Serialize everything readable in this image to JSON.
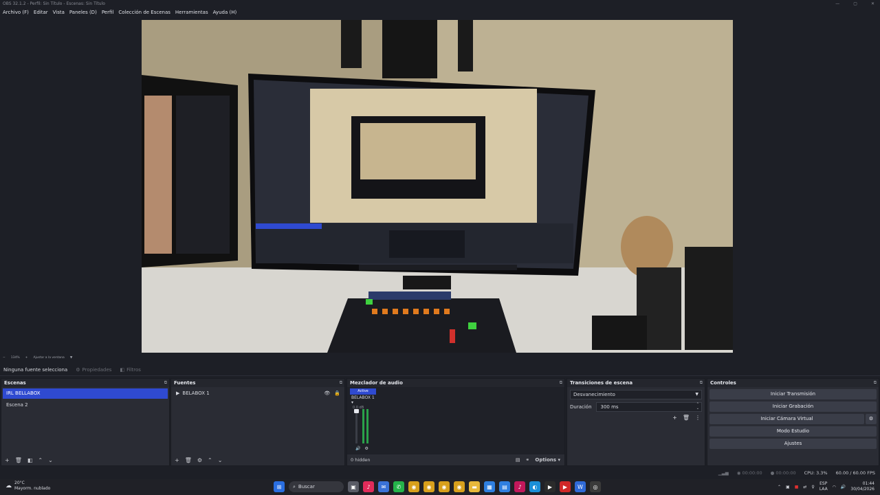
{
  "window": {
    "title": "OBS 32.1.2 - Perfil: Sin Título - Escenas: Sin Título",
    "controls": [
      "—",
      "▢",
      "✕"
    ]
  },
  "menu": [
    "Archivo (F)",
    "Editar",
    "Vista",
    "Paneles (D)",
    "Perfil",
    "Colección de Escenas",
    "Herramientas",
    "Ayuda (H)"
  ],
  "zoom": {
    "level": "134%",
    "fit": "Ajustar a la ventana",
    "minus": "−"
  },
  "source_bar": {
    "no_source": "Ninguna fuente selecciona",
    "properties": "Propiedades",
    "filters": "Filtros"
  },
  "scenes": {
    "title": "Escenas",
    "items": [
      "IRL BELLABOX",
      "Escena 2"
    ],
    "selected": 0
  },
  "sources": {
    "title": "Fuentes",
    "items": [
      "BELABOX 1"
    ]
  },
  "mixer": {
    "title": "Mezclador de audio",
    "active_label": "Active",
    "channel": "BELABOX 1",
    "db": "0.0 dB",
    "hidden": "0 hidden",
    "options": "Options"
  },
  "transitions": {
    "title": "Transiciones de escena",
    "type": "Desvanecimiento",
    "duration_label": "Duración",
    "duration_value": "300 ms"
  },
  "controls": {
    "title": "Controles",
    "start_stream": "Iniciar Transmisión",
    "start_record": "Iniciar Grabación",
    "virtual_cam": "Iniciar Cámara Virtual",
    "studio_mode": "Modo Estudio",
    "settings": "Ajustes"
  },
  "status": {
    "stream_time": "00:00:00",
    "record_time": "00:00:00",
    "cpu": "CPU: 3.3%",
    "fps": "60.00 / 60.00 FPS"
  },
  "taskbar": {
    "temp": "20°C",
    "weather": "Mayorm. nublado",
    "search": "Buscar",
    "lang_top": "ESP",
    "lang_bottom": "LAA",
    "time": "01:44",
    "date": "30/04/2026"
  },
  "colors": {
    "accent": "#2f4ad0",
    "panel": "#2a2c34",
    "background": "#1d1f26"
  }
}
